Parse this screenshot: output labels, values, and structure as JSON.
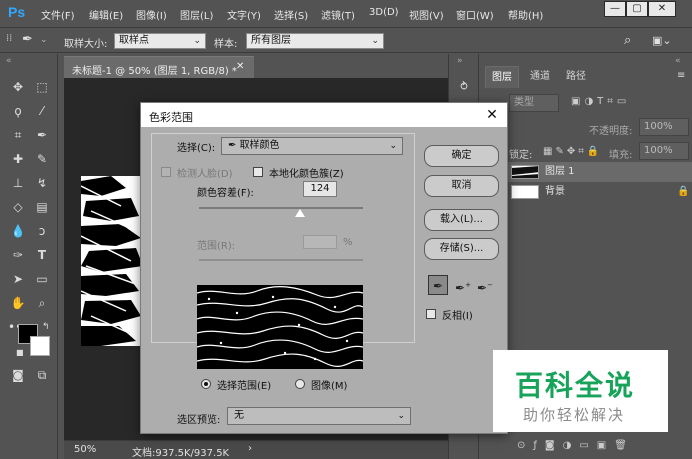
{
  "app": {
    "logo": "Ps"
  },
  "menu": [
    "文件(F)",
    "编辑(E)",
    "图像(I)",
    "图层(L)",
    "文字(Y)",
    "选择(S)",
    "滤镜(T)",
    "3D(D)",
    "视图(V)",
    "窗口(W)",
    "帮助(H)"
  ],
  "window_controls": {
    "minimize": "—",
    "restore": "▢",
    "close": "✕"
  },
  "options_bar": {
    "sample_size_label": "取样大小:",
    "sample_size_value": "取样点",
    "sample_label": "样本:",
    "sample_value": "所有图层"
  },
  "document": {
    "tab_title": "未标题-1 @ 50% (图层 1, RGB/8) *",
    "tab_close": "✕",
    "zoom": "50%",
    "doc_info": "文档:937.5K/937.5K",
    "status_arrow": "›"
  },
  "panels": {
    "tabs": [
      "图层",
      "通道",
      "路径"
    ],
    "kind_label": "类型",
    "opacity_label": "不透明度:",
    "opacity_value": "100%",
    "lock_label": "锁定:",
    "fill_label": "填充:",
    "fill_value": "100%",
    "layers": [
      {
        "name": "图层 1"
      },
      {
        "name": "背景"
      }
    ]
  },
  "dialog": {
    "title": "色彩范围",
    "close": "✕",
    "select_label": "选择(C):",
    "select_value": "取样颜色",
    "detect_faces": "检测人脸(D)",
    "localized_clusters": "本地化颜色簇(Z)",
    "fuzziness_label": "颜色容差(F):",
    "fuzziness_value": "124",
    "range_label": "范围(R):",
    "range_unit": "%",
    "radio_selection": "选择范围(E)",
    "radio_image": "图像(M)",
    "preview_label": "选区预览:",
    "preview_value": "无",
    "buttons": {
      "ok": "确定",
      "cancel": "取消",
      "load": "载入(L)...",
      "save": "存储(S)..."
    },
    "invert": "反相(I)"
  },
  "watermark": {
    "title": "百科全说",
    "subtitle": "助你轻松解决"
  }
}
